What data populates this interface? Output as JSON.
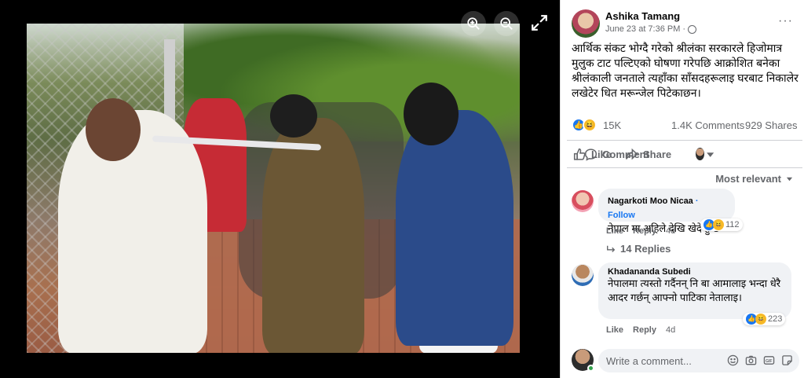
{
  "viewer": {
    "zoom_in_icon": "zoom-in-icon",
    "zoom_out_icon": "zoom-out-icon",
    "fullscreen_icon": "expand-icon"
  },
  "post": {
    "author": "Ashika Tamang",
    "date": "June 23 at 7:36 PM",
    "separator": "·",
    "caption": "आर्थिक संकट भोग्दै गरेको श्रीलंका सरकारले हिजोमात्र मुलुक टाट पल्टिएको घोषणा गरेपछि आक्रोशित बनेका श्रीलंकाली जनताले त्यहाँका साँसदहरूलाइ घरबाट निकालेर लखेटेर धित मरून्जेल पिटेकाछन।",
    "more_label": "···"
  },
  "stats": {
    "reactions": "15K",
    "comments": "1.4K Comments",
    "shares": "929 Shares"
  },
  "actions": {
    "like": "Like",
    "comment": "Comment",
    "share": "Share"
  },
  "sort_label": "Most relevant",
  "comments": [
    {
      "name": "Nagarkoti Moo Nicaa",
      "follow": "Follow",
      "separator": " · ",
      "text": "नेपाल मा अहिले देखि खेदे हुन्छ",
      "reactions": "112",
      "like": "Like",
      "reply": "Reply",
      "time": "4d",
      "replies": "14 Replies"
    },
    {
      "name": "Khadananda Subedi",
      "text": "नेपालमा त्यस्तो गर्दैनन् नि बा आमालाइ भन्दा धेरै आदर गर्छन् आफ्नो पाटिका नेतालाइ।",
      "reactions": "223",
      "like": "Like",
      "reply": "Reply",
      "time": "4d"
    }
  ],
  "writer": {
    "placeholder": "Write a comment..."
  },
  "colors": {
    "accent": "#1877f2",
    "haha": "#f7b928",
    "online": "#31a24c"
  }
}
